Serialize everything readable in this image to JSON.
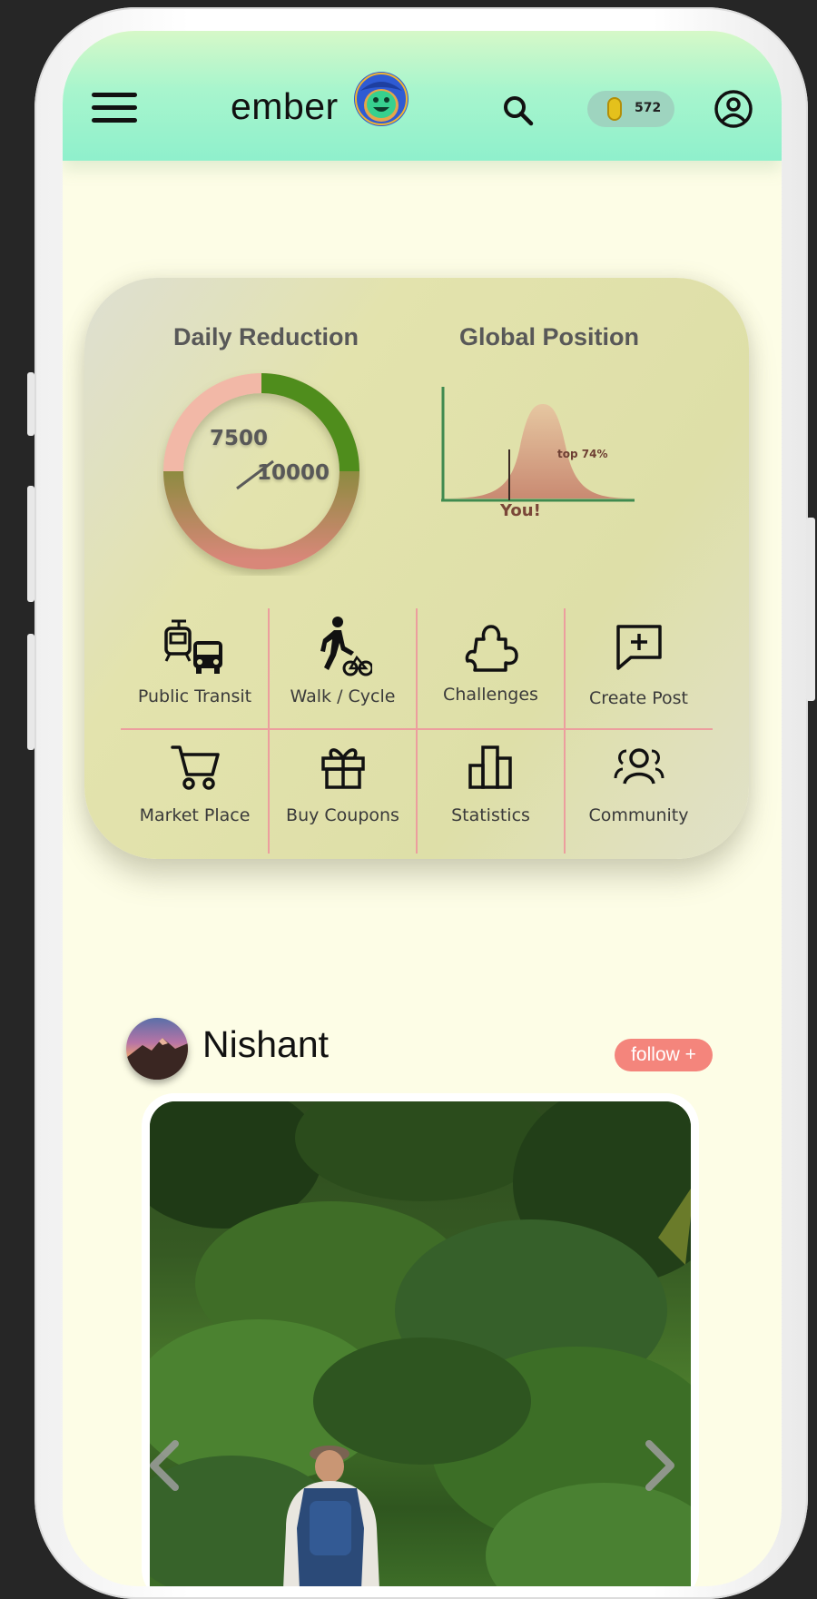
{
  "app": {
    "brand": "ember",
    "coins": "572"
  },
  "stats": {
    "daily_reduction": {
      "title": "Daily Reduction",
      "current": "7500",
      "target": "10000"
    },
    "global_position": {
      "title": "Global Position",
      "annotation": "top 74%",
      "marker_label": "You!"
    }
  },
  "actions": [
    {
      "label": "Public Transit",
      "icon": "bus-tram-icon"
    },
    {
      "label": "Walk / Cycle",
      "icon": "walk-bike-icon"
    },
    {
      "label": "Challenges",
      "icon": "puzzle-icon"
    },
    {
      "label": "Create Post",
      "icon": "add-comment-icon"
    },
    {
      "label": "Market Place",
      "icon": "cart-icon"
    },
    {
      "label": "Buy Coupons",
      "icon": "gift-icon"
    },
    {
      "label": "Statistics",
      "icon": "bar-chart-icon"
    },
    {
      "label": "Community",
      "icon": "group-icon"
    }
  ],
  "post": {
    "author": "Nishant",
    "follow_label": "follow +"
  },
  "colors": {
    "topbar": "#a8f5cd",
    "background": "#fdfde6",
    "accent": "#f4857c",
    "grid_line": "#ec9e9e"
  }
}
